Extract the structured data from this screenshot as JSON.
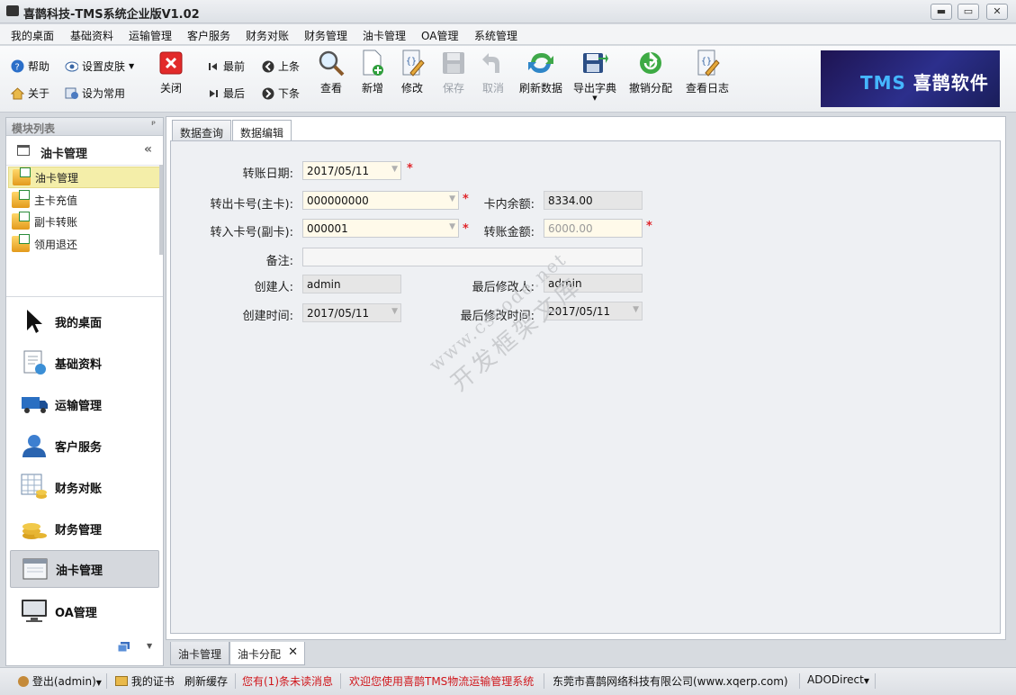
{
  "window": {
    "title": "喜鹊科技-TMS系统企业版V1.02",
    "min": "▬",
    "max": "▭",
    "close": "✕"
  },
  "menu": [
    "我的桌面",
    "基础资料",
    "运输管理",
    "客户服务",
    "财务对账",
    "财务管理",
    "油卡管理",
    "OA管理",
    "系统管理"
  ],
  "toolbar": {
    "help": "帮助",
    "skin": "设置皮肤",
    "about": "关于",
    "favorite": "设为常用",
    "close": "关闭",
    "first": "最前",
    "last": "最后",
    "prev": "上条",
    "next": "下条",
    "view": "查看",
    "add": "新增",
    "edit": "修改",
    "save": "保存",
    "cancel": "取消",
    "refresh": "刷新数据",
    "export": "导出字典",
    "undo_assign": "撤销分配",
    "log": "查看日志"
  },
  "banner": {
    "brand": "TMS",
    "name": "喜鹊软件"
  },
  "left": {
    "header": "模块列表",
    "pin": "ᵖ",
    "group": "油卡管理",
    "collapse": "«",
    "items": [
      "油卡管理",
      "主卡充值",
      "副卡转账",
      "领用退还"
    ],
    "nav": [
      "我的桌面",
      "基础资料",
      "运输管理",
      "客户服务",
      "财务对账",
      "财务管理",
      "油卡管理",
      "OA管理"
    ]
  },
  "tabs": [
    "数据查询",
    "数据编辑"
  ],
  "form": {
    "transfer_date_label": "转账日期:",
    "transfer_date": "2017/05/11",
    "out_card_label": "转出卡号(主卡):",
    "out_card": "000000000",
    "balance_label": "卡内余额:",
    "balance": "8334.00",
    "in_card_label": "转入卡号(副卡):",
    "in_card": "000001",
    "amount_label": "转账金额:",
    "amount": "6000.00",
    "remark_label": "备注:",
    "remark": "",
    "creator_label": "创建人:",
    "creator": "admin",
    "modifier_label": "最后修改人:",
    "modifier": "admin",
    "created_label": "创建时间:",
    "created": "2017/05/11",
    "modified_label": "最后修改时间:",
    "modified": "2017/05/11",
    "required": "*"
  },
  "watermark": {
    "line1": "www.cscode.net",
    "line2": "开发框架文库"
  },
  "doctabs": [
    "油卡管理",
    "油卡分配"
  ],
  "status": {
    "logout": "登出(admin)",
    "cert": "我的证书",
    "cache": "刷新缓存",
    "unread": "您有(1)条未读消息",
    "welcome": "欢迎您使用喜鹊TMS物流运输管理系统",
    "company": "东莞市喜鹊网络科技有限公司(www.xqerp.com)",
    "db": "ADODirect"
  }
}
